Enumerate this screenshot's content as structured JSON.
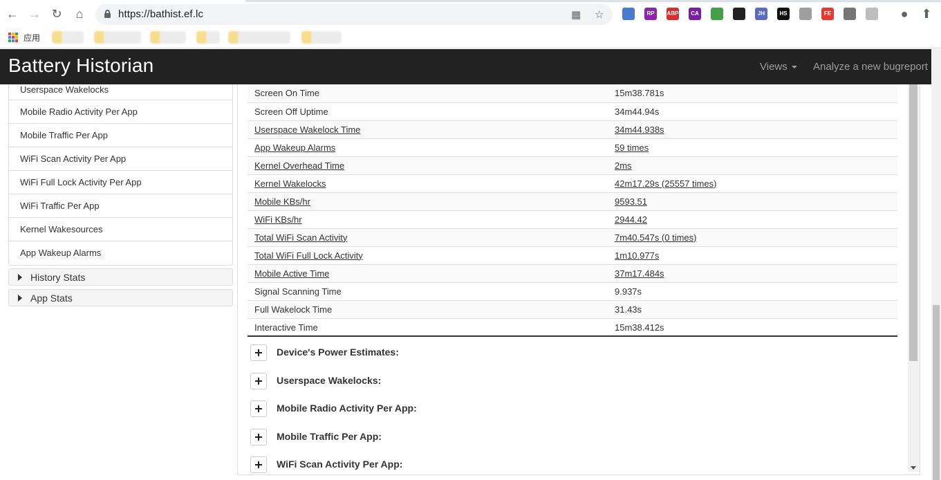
{
  "browser": {
    "url": "https://bathist.ef.lc",
    "bookmarks_label": "应用"
  },
  "extensions": [
    {
      "name": "opera-icon",
      "color": "#4a7bd0",
      "text": ""
    },
    {
      "name": "rp-icon",
      "color": "#8e24aa",
      "text": "RP"
    },
    {
      "name": "abp-icon",
      "color": "#d32f2f",
      "text": "ABP"
    },
    {
      "name": "ca-icon",
      "color": "#7b1fa2",
      "text": "CA"
    },
    {
      "name": "pinwheel-icon",
      "color": "#43a047",
      "text": ""
    },
    {
      "name": "owl-icon",
      "color": "#222222",
      "text": ""
    },
    {
      "name": "jh-icon",
      "color": "#5c6bc0",
      "text": "JH"
    },
    {
      "name": "hs-icon",
      "color": "#111111",
      "text": "HS"
    },
    {
      "name": "tree-icon",
      "color": "#9e9e9e",
      "text": ""
    },
    {
      "name": "fe-icon",
      "color": "#e53935",
      "text": "FE"
    },
    {
      "name": "check-icon",
      "color": "#757575",
      "text": ""
    },
    {
      "name": "android-icon",
      "color": "#bdbdbd",
      "text": ""
    }
  ],
  "header": {
    "brand": "Battery Historian",
    "views": "Views",
    "analyze": "Analyze a new bugreport"
  },
  "sidebar": {
    "items": [
      "Userspace Wakelocks",
      "Mobile Radio Activity Per App",
      "Mobile Traffic Per App",
      "WiFi Scan Activity Per App",
      "WiFi Full Lock Activity Per App",
      "WiFi Traffic Per App",
      "Kernel Wakesources",
      "App Wakeup Alarms"
    ],
    "panels": [
      "History Stats",
      "App Stats"
    ]
  },
  "stats": [
    {
      "key": "Screen On Time",
      "value": "15m38.781s",
      "link": false
    },
    {
      "key": "Screen Off Uptime",
      "value": "34m44.94s",
      "link": false
    },
    {
      "key": "Userspace Wakelock Time",
      "value": "34m44.938s",
      "link": true
    },
    {
      "key": "App Wakeup Alarms",
      "value": "59 times",
      "link": true
    },
    {
      "key": "Kernel Overhead Time",
      "value": "2ms",
      "link": true
    },
    {
      "key": "Kernel Wakelocks",
      "value": "42m17.29s (25557 times)",
      "link": true
    },
    {
      "key": "Mobile KBs/hr",
      "value": "9593.51",
      "link": true
    },
    {
      "key": "WiFi KBs/hr",
      "value": "2944.42",
      "link": true
    },
    {
      "key": "Total WiFi Scan Activity",
      "value": "7m40.547s (0 times)",
      "link": true
    },
    {
      "key": "Total WiFi Full Lock Activity",
      "value": "1m10.977s",
      "link": true
    },
    {
      "key": "Mobile Active Time",
      "value": "37m17.484s",
      "link": true
    },
    {
      "key": "Signal Scanning Time",
      "value": "9.937s",
      "link": false
    },
    {
      "key": "Full Wakelock Time",
      "value": "31.43s",
      "link": false
    },
    {
      "key": "Interactive Time",
      "value": "15m38.412s",
      "link": false
    }
  ],
  "sections": [
    "Device's Power Estimates:",
    "Userspace Wakelocks:",
    "Mobile Radio Activity Per App:",
    "Mobile Traffic Per App:",
    "WiFi Scan Activity Per App:"
  ]
}
